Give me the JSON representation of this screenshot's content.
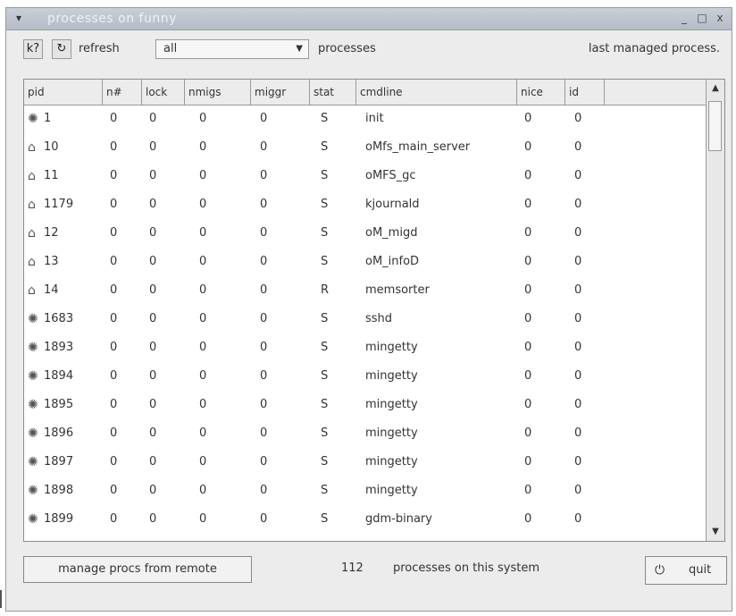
{
  "window": {
    "title": "processes on funny",
    "title_buttons": [
      "_",
      "□",
      "x"
    ]
  },
  "toolbar": {
    "help_icon": "k?",
    "refresh_icon": "↻",
    "refresh_label": "refresh",
    "filter_value": "all",
    "processes_label": "processes",
    "last_label": "last managed process."
  },
  "table": {
    "columns": [
      "pid",
      "n#",
      "lock",
      "nmigs",
      "miggr",
      "stat",
      "cmdline",
      "nice",
      "id"
    ],
    "rows": [
      {
        "icon": "daemon-icon",
        "pid": "1",
        "n": "0",
        "lock": "0",
        "nmigs": "0",
        "miggr": "0",
        "stat": "S",
        "cmdline": "init",
        "nice": "0",
        "id": "0"
      },
      {
        "icon": "lock-icon",
        "pid": "10",
        "n": "0",
        "lock": "0",
        "nmigs": "0",
        "miggr": "0",
        "stat": "S",
        "cmdline": "oMfs_main_server",
        "nice": "0",
        "id": "0"
      },
      {
        "icon": "lock-icon",
        "pid": "11",
        "n": "0",
        "lock": "0",
        "nmigs": "0",
        "miggr": "0",
        "stat": "S",
        "cmdline": "oMFS_gc",
        "nice": "0",
        "id": "0"
      },
      {
        "icon": "lock-icon",
        "pid": "1179",
        "n": "0",
        "lock": "0",
        "nmigs": "0",
        "miggr": "0",
        "stat": "S",
        "cmdline": "kjournald",
        "nice": "0",
        "id": "0"
      },
      {
        "icon": "lock-icon",
        "pid": "12",
        "n": "0",
        "lock": "0",
        "nmigs": "0",
        "miggr": "0",
        "stat": "S",
        "cmdline": "oM_migd",
        "nice": "0",
        "id": "0"
      },
      {
        "icon": "lock-icon",
        "pid": "13",
        "n": "0",
        "lock": "0",
        "nmigs": "0",
        "miggr": "0",
        "stat": "S",
        "cmdline": "oM_infoD",
        "nice": "0",
        "id": "0"
      },
      {
        "icon": "lock-icon",
        "pid": "14",
        "n": "0",
        "lock": "0",
        "nmigs": "0",
        "miggr": "0",
        "stat": "R",
        "cmdline": "memsorter",
        "nice": "0",
        "id": "0"
      },
      {
        "icon": "daemon-icon",
        "pid": "1683",
        "n": "0",
        "lock": "0",
        "nmigs": "0",
        "miggr": "0",
        "stat": "S",
        "cmdline": "sshd",
        "nice": "0",
        "id": "0"
      },
      {
        "icon": "daemon-icon",
        "pid": "1893",
        "n": "0",
        "lock": "0",
        "nmigs": "0",
        "miggr": "0",
        "stat": "S",
        "cmdline": "mingetty",
        "nice": "0",
        "id": "0"
      },
      {
        "icon": "daemon-icon",
        "pid": "1894",
        "n": "0",
        "lock": "0",
        "nmigs": "0",
        "miggr": "0",
        "stat": "S",
        "cmdline": "mingetty",
        "nice": "0",
        "id": "0"
      },
      {
        "icon": "daemon-icon",
        "pid": "1895",
        "n": "0",
        "lock": "0",
        "nmigs": "0",
        "miggr": "0",
        "stat": "S",
        "cmdline": "mingetty",
        "nice": "0",
        "id": "0"
      },
      {
        "icon": "daemon-icon",
        "pid": "1896",
        "n": "0",
        "lock": "0",
        "nmigs": "0",
        "miggr": "0",
        "stat": "S",
        "cmdline": "mingetty",
        "nice": "0",
        "id": "0"
      },
      {
        "icon": "daemon-icon",
        "pid": "1897",
        "n": "0",
        "lock": "0",
        "nmigs": "0",
        "miggr": "0",
        "stat": "S",
        "cmdline": "mingetty",
        "nice": "0",
        "id": "0"
      },
      {
        "icon": "daemon-icon",
        "pid": "1898",
        "n": "0",
        "lock": "0",
        "nmigs": "0",
        "miggr": "0",
        "stat": "S",
        "cmdline": "mingetty",
        "nice": "0",
        "id": "0"
      },
      {
        "icon": "daemon-icon",
        "pid": "1899",
        "n": "0",
        "lock": "0",
        "nmigs": "0",
        "miggr": "0",
        "stat": "S",
        "cmdline": "gdm-binary",
        "nice": "0",
        "id": "0"
      }
    ]
  },
  "footer": {
    "remote_button": "manage procs from remote",
    "count": "112",
    "count_label": "processes on this system",
    "quit_label": "quit"
  }
}
